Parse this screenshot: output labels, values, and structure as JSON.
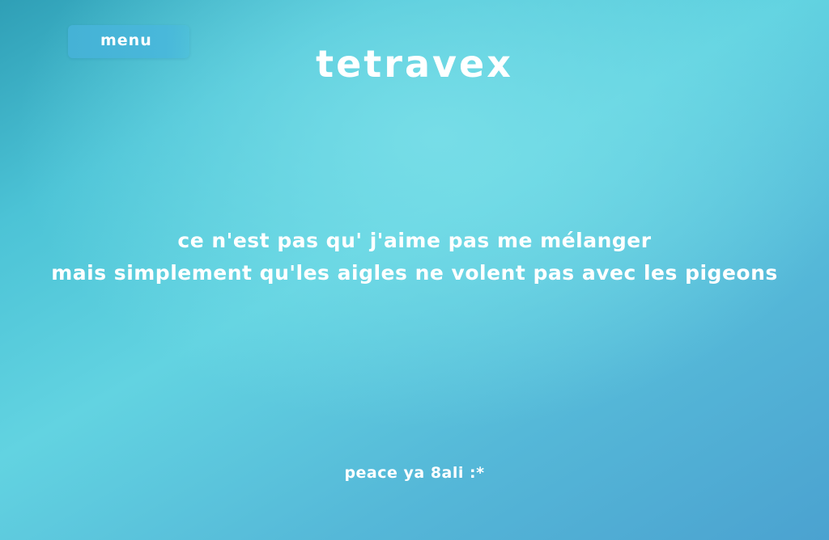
{
  "menu": {
    "label": "menu"
  },
  "header": {
    "title": "tetravex"
  },
  "main": {
    "quote_lines": [
      "ce n'est pas qu' j'aime pas me mélanger",
      "mais simplement qu'les aigles ne volent pas avec les pigeons"
    ]
  },
  "footer": {
    "note": "peace ya 8ali :*"
  },
  "colors": {
    "background_light": "#62d3e1",
    "background_dark": "#4ba2d0",
    "menu_button": "#45b2d6",
    "text": "#ffffff"
  }
}
